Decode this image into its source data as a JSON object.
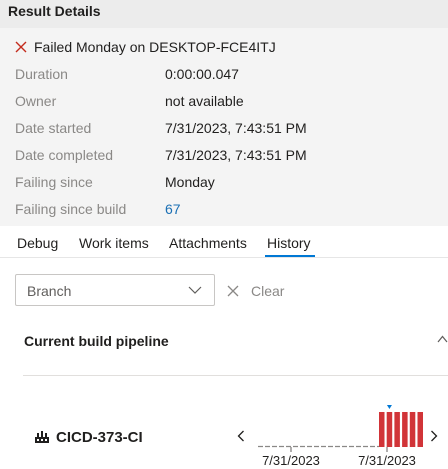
{
  "header": {
    "title": "Result Details"
  },
  "status": {
    "text": "Failed Monday on DESKTOP-FCE4ITJ",
    "icon": "close-icon",
    "color": "#c42b1c"
  },
  "details": [
    {
      "label": "Duration",
      "value": "0:00:00.047"
    },
    {
      "label": "Owner",
      "value": "not available"
    },
    {
      "label": "Date started",
      "value": "7/31/2023, 7:43:51 PM"
    },
    {
      "label": "Date completed",
      "value": "7/31/2023, 7:43:51 PM"
    },
    {
      "label": "Failing since",
      "value": "Monday"
    },
    {
      "label": "Failing since build",
      "value": "67",
      "is_link": true
    }
  ],
  "tabs": [
    {
      "label": "Debug",
      "active": false
    },
    {
      "label": "Work items",
      "active": false
    },
    {
      "label": "Attachments",
      "active": false
    },
    {
      "label": "History",
      "active": true
    }
  ],
  "filter": {
    "branch_placeholder": "Branch",
    "clear_label": "Clear"
  },
  "section": {
    "title": "Current build pipeline",
    "expanded": true
  },
  "pipeline": {
    "name": "CICD-373-CI",
    "icon": "build-pipeline-icon"
  },
  "colors": {
    "accent": "#0078d4",
    "failed": "#d13438",
    "link": "#1a6fb4"
  },
  "chart_data": {
    "type": "bar",
    "x_tick_labels": [
      "7/31/2023",
      "7/31/2023"
    ],
    "bars": {
      "count_with_results": 6,
      "empty_slots": 12,
      "status": "failed"
    },
    "selected_marker": true
  }
}
